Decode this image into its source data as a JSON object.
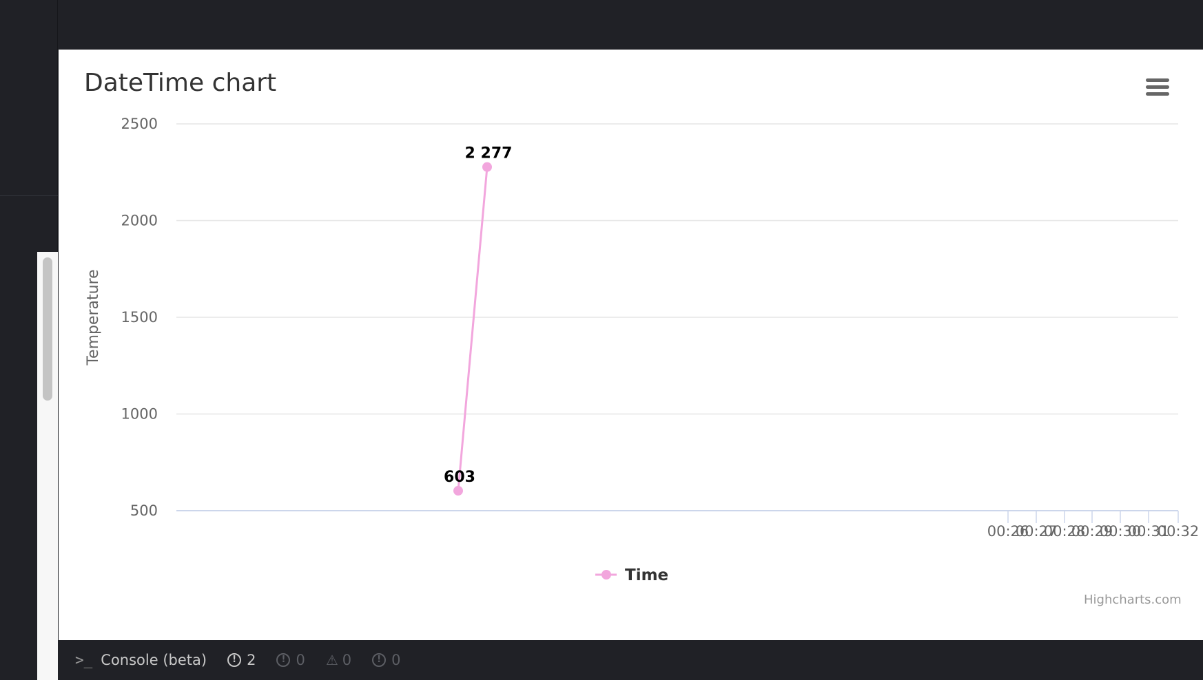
{
  "console": {
    "label": "Console (beta)",
    "errors": "2",
    "info_a": "0",
    "warnings": "0",
    "info_b": "0"
  },
  "chart_data": {
    "type": "line",
    "title": "DateTime chart",
    "ylabel": "Temperature",
    "xlabel": "",
    "y_ticks": [
      500,
      1000,
      1500,
      2000,
      2500
    ],
    "ylim": [
      500,
      2500
    ],
    "x_tick_labels": [
      "00:26",
      "00:27",
      "00:28",
      "00:29",
      "00:30",
      "00:31",
      "00:32"
    ],
    "series": [
      {
        "name": "Time",
        "color": "#f2a6dd",
        "points": [
          {
            "value": 603,
            "label": "603"
          },
          {
            "value": 2277,
            "label": "2 277"
          }
        ]
      }
    ],
    "legend": "bottom-center",
    "credits": "Highcharts.com",
    "grid": true
  }
}
